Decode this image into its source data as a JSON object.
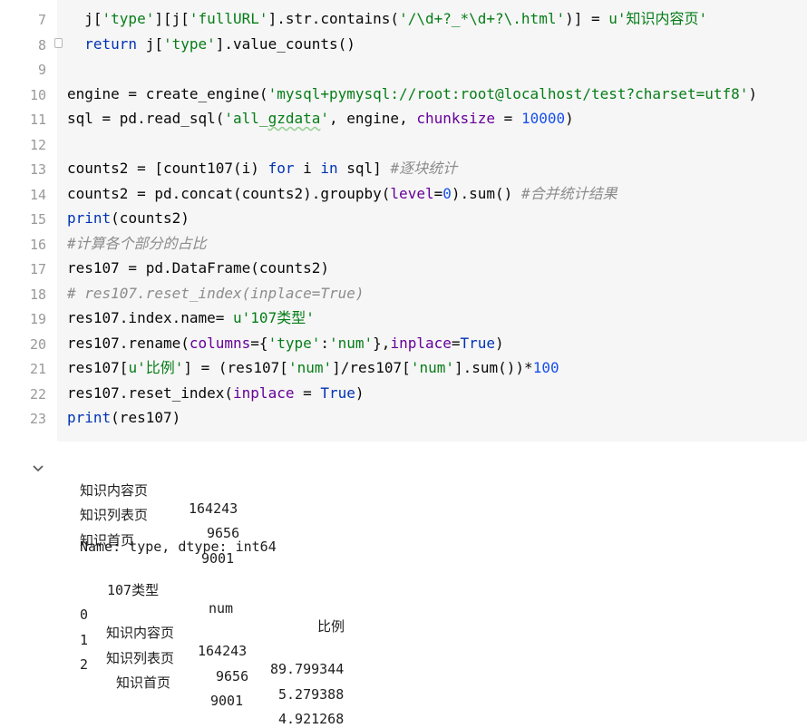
{
  "editor": {
    "line_numbers": [
      "7",
      "8",
      "9",
      "10",
      "11",
      "12",
      "13",
      "14",
      "15",
      "16",
      "17",
      "18",
      "19",
      "20",
      "21",
      "22",
      "23"
    ],
    "lines": [
      [
        {
          "t": "  j[",
          "c": ""
        },
        {
          "t": "'type'",
          "c": "str"
        },
        {
          "t": "][j[",
          "c": ""
        },
        {
          "t": "'fullURL'",
          "c": "str"
        },
        {
          "t": "].str.contains(",
          "c": ""
        },
        {
          "t": "'/\\d+?_*\\d+?\\.html'",
          "c": "str"
        },
        {
          "t": ")] = ",
          "c": ""
        },
        {
          "t": "u'知识内容页'",
          "c": "str"
        }
      ],
      [
        {
          "t": "  ",
          "c": ""
        },
        {
          "t": "return",
          "c": "kw"
        },
        {
          "t": " j[",
          "c": ""
        },
        {
          "t": "'type'",
          "c": "str"
        },
        {
          "t": "].value_counts()",
          "c": ""
        }
      ],
      [],
      [
        {
          "t": "engine = create_engine(",
          "c": ""
        },
        {
          "t": "'mysql+pymysql://root:root@localhost/test?charset=utf8'",
          "c": "str"
        },
        {
          "t": ")",
          "c": ""
        }
      ],
      [
        {
          "t": "sql = pd.read_sql(",
          "c": ""
        },
        {
          "t": "'all_",
          "c": "str"
        },
        {
          "t": "gzdata",
          "c": "str u"
        },
        {
          "t": "'",
          "c": "str"
        },
        {
          "t": ", engine, ",
          "c": ""
        },
        {
          "t": "chunksize",
          "c": "param"
        },
        {
          "t": " = ",
          "c": ""
        },
        {
          "t": "10000",
          "c": "num"
        },
        {
          "t": ")",
          "c": ""
        }
      ],
      [],
      [
        {
          "t": "counts2 = [count107(i) ",
          "c": ""
        },
        {
          "t": "for",
          "c": "kw"
        },
        {
          "t": " i ",
          "c": ""
        },
        {
          "t": "in",
          "c": "kw"
        },
        {
          "t": " sql] ",
          "c": ""
        },
        {
          "t": "#逐块统计",
          "c": "com"
        }
      ],
      [
        {
          "t": "counts2 = pd.concat(counts2).groupby(",
          "c": ""
        },
        {
          "t": "level",
          "c": "param"
        },
        {
          "t": "=",
          "c": ""
        },
        {
          "t": "0",
          "c": "num"
        },
        {
          "t": ").sum() ",
          "c": ""
        },
        {
          "t": "#合并统计结果",
          "c": "com"
        }
      ],
      [
        {
          "t": "print",
          "c": "kw"
        },
        {
          "t": "(counts2)",
          "c": ""
        }
      ],
      [
        {
          "t": "#计算各个部分的占比",
          "c": "com"
        }
      ],
      [
        {
          "t": "res107 = pd.DataFrame(counts2)",
          "c": ""
        }
      ],
      [
        {
          "t": "# res107.reset_index(inplace=True)",
          "c": "com"
        }
      ],
      [
        {
          "t": "res107.index.name= ",
          "c": ""
        },
        {
          "t": "u'107类型'",
          "c": "str"
        }
      ],
      [
        {
          "t": "res107.rename(",
          "c": ""
        },
        {
          "t": "columns",
          "c": "param"
        },
        {
          "t": "={",
          "c": ""
        },
        {
          "t": "'type'",
          "c": "str"
        },
        {
          "t": ":",
          "c": ""
        },
        {
          "t": "'num'",
          "c": "str"
        },
        {
          "t": "},",
          "c": ""
        },
        {
          "t": "inplace",
          "c": "param"
        },
        {
          "t": "=",
          "c": ""
        },
        {
          "t": "True",
          "c": "kw"
        },
        {
          "t": ")",
          "c": ""
        }
      ],
      [
        {
          "t": "res107[",
          "c": ""
        },
        {
          "t": "u'比例'",
          "c": "str"
        },
        {
          "t": "] = (res107[",
          "c": ""
        },
        {
          "t": "'num'",
          "c": "str"
        },
        {
          "t": "]/res107[",
          "c": ""
        },
        {
          "t": "'num'",
          "c": "str"
        },
        {
          "t": "].sum())*",
          "c": ""
        },
        {
          "t": "100",
          "c": "num"
        }
      ],
      [
        {
          "t": "res107.reset_index(",
          "c": ""
        },
        {
          "t": "inplace",
          "c": "param"
        },
        {
          "t": " = ",
          "c": ""
        },
        {
          "t": "True",
          "c": "kw"
        },
        {
          "t": ")",
          "c": ""
        }
      ],
      [
        {
          "t": "print",
          "c": "kw"
        },
        {
          "t": "(res107)",
          "c": ""
        }
      ]
    ]
  },
  "output": {
    "series": [
      {
        "label": "知识内容页",
        "value": "164243"
      },
      {
        "label": "知识列表页",
        "value": "9656"
      },
      {
        "label": "知识首页",
        "value": "9001"
      }
    ],
    "series_footer": "Name: type, dtype: int64",
    "df_header": {
      "index_name": "107类型",
      "col1": "num",
      "col2": "比例"
    },
    "df_rows": [
      {
        "idx": "0",
        "type": "知识内容页",
        "num": "164243",
        "ratio": "89.799344"
      },
      {
        "idx": "1",
        "type": "知识列表页",
        "num": "9656",
        "ratio": "5.279388"
      },
      {
        "idx": "2",
        "type": "知识首页",
        "num": "9001",
        "ratio": "4.921268"
      }
    ]
  },
  "colors": {
    "string": "#067d17",
    "number": "#1750eb",
    "keyword": "#0033b3",
    "parameter": "#660099",
    "comment": "#8c8c8c",
    "code_bg": "#f6f6f6"
  },
  "icons": {
    "collapse_output": "chevron-down-icon",
    "fold_marker": "fold-marker-icon"
  }
}
